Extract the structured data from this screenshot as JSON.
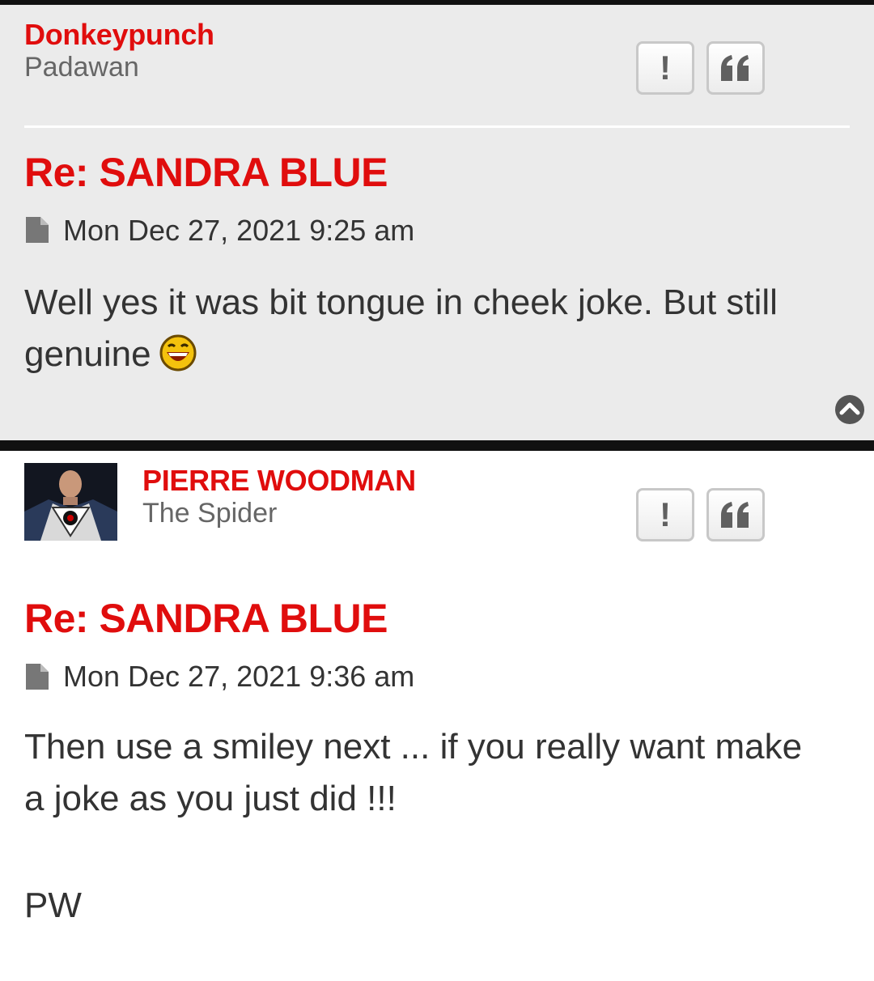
{
  "posts": [
    {
      "author": "Donkeypunch",
      "rank": "Padawan",
      "title": "Re: SANDRA BLUE",
      "date": "Mon Dec 27, 2021 9:25 am",
      "body": "Well yes it was bit tongue in cheek joke. But still genuine",
      "report_label": "!",
      "quote_icon": "quote-icon",
      "has_smiley": true
    },
    {
      "author": "PIERRE WOODMAN",
      "rank": "The Spider",
      "title": "Re: SANDRA BLUE",
      "date": "Mon Dec 27, 2021 9:36 am",
      "body_line1": "Then use a smiley next ... if you really want make",
      "body_line2": "a joke as you just did !!!",
      "signature": "PW",
      "report_label": "!",
      "quote_icon": "quote-icon"
    }
  ],
  "icons": {
    "post_icon": "file-icon",
    "back_to_top": "chevron-up-circle-icon",
    "smiley": "laughing-smiley-icon"
  },
  "colors": {
    "accent": "#e00d0d",
    "post_bg_alt": "#ebebeb",
    "text": "#333333"
  }
}
